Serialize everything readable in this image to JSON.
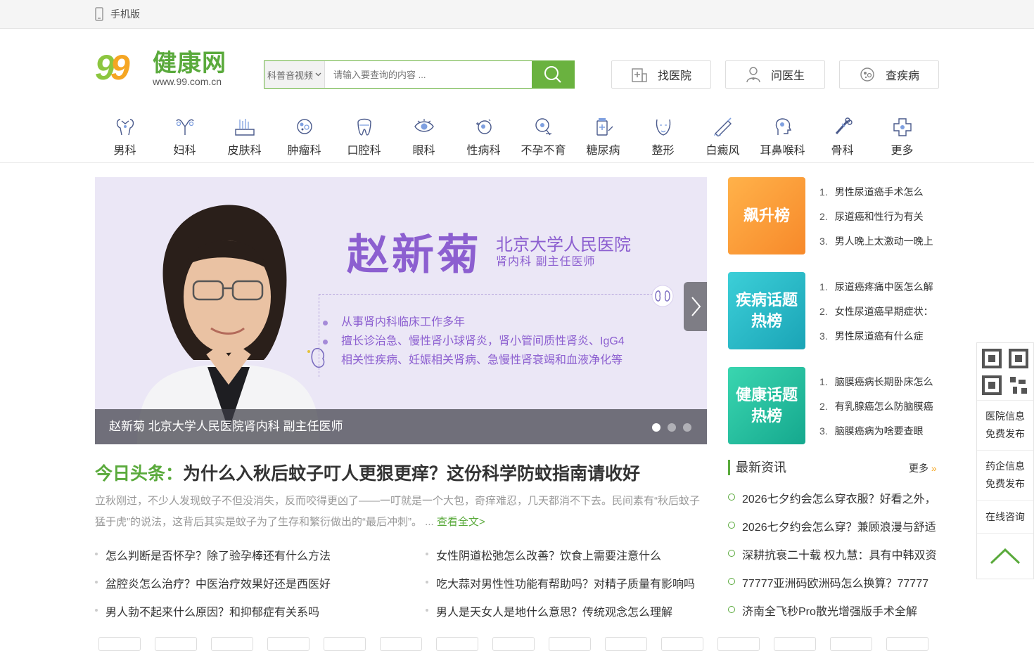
{
  "topbar": {
    "mobile_label": "手机版"
  },
  "logo": {
    "num": "99",
    "cn": "健康网",
    "url": "www.99.com.cn"
  },
  "search": {
    "select_value": "科普音视频",
    "placeholder": "请输入要查询的内容 ..."
  },
  "quick_buttons": {
    "hospital": "找医院",
    "doctor": "问医生",
    "disease": "查疾病"
  },
  "departments": [
    "男科",
    "妇科",
    "皮肤科",
    "肿瘤科",
    "口腔科",
    "眼科",
    "性病科",
    "不孕不育",
    "糖尿病",
    "整形",
    "白癜风",
    "耳鼻喉科",
    "骨科",
    "更多"
  ],
  "banner": {
    "doctor_name": "赵新菊",
    "hospital": "北京大学人民医院",
    "title": "肾内科  副主任医师",
    "bullet1": "从事肾内科临床工作多年",
    "bullet2_line1": "擅长诊治急、慢性肾小球肾炎，肾小管间质性肾炎、IgG4",
    "bullet2_line2": "相关性疾病、妊娠相关肾病、急慢性肾衰竭和血液净化等",
    "caption": "赵新菊 北京大学人民医院肾内科 副主任医师"
  },
  "headline": {
    "tag": "今日头条：",
    "title": "为什么入秋后蚊子叮人更狠更痒？这份科学防蚊指南请收好",
    "summary": "立秋刚过，不少人发现蚊子不但没消失，反而咬得更凶了——一叮就是一个大包，奇痒难忍，几天都消不下去。民间素有“秋后蚊子猛于虎”的说法，这背后其实是蚊子为了生存和繁衍做出的“最后冲刺”。 ... ",
    "more": "查看全文>"
  },
  "news": {
    "left": [
      "怎么判断是否怀孕？除了验孕棒还有什么方法",
      "盆腔炎怎么治疗？中医治疗效果好还是西医好",
      "男人勃不起来什么原因？和抑郁症有关系吗"
    ],
    "right": [
      "女性阴道松弛怎么改善？饮食上需要注意什么",
      "吃大蒜对男性性功能有帮助吗？对精子质量有影响吗",
      "男人是天女人是地什么意思？传统观念怎么理解"
    ]
  },
  "rankings": [
    {
      "label": "飙升榜",
      "items": [
        "男性尿道癌手术怎么",
        "尿道癌和性行为有关",
        "男人晚上太激动一晚上"
      ]
    },
    {
      "label_line1": "疾病话题",
      "label_line2": "热榜",
      "items": [
        "尿道癌疼痛中医怎么解",
        "女性尿道癌早期症状：",
        "男性尿道癌有什么症"
      ]
    },
    {
      "label_line1": "健康话题",
      "label_line2": "热榜",
      "items": [
        "脑膜癌病长期卧床怎么",
        "有乳腺癌怎么防脑膜癌",
        "脑膜癌病为啥要查眼"
      ]
    }
  ],
  "latest": {
    "title": "最新资讯",
    "more": "更多",
    "items": [
      "2026七夕约会怎么穿衣服？好看之外，",
      "2026七夕约会怎么穿？兼顾浪漫与舒适",
      "深耕抗衰二十载 权九慧：具有中韩双资",
      "77777亚洲码欧洲码怎么换算？77777",
      "济南全飞秒Pro散光增强版手术全解"
    ]
  },
  "sidebar": {
    "hospital_l1": "医院信息",
    "hospital_l2": "免费发布",
    "pharma_l1": "药企信息",
    "pharma_l2": "免费发布",
    "consult": "在线咨询"
  },
  "colors": {
    "brand_green": "#5aaa3c",
    "accent_orange": "#f5a623",
    "banner_purple": "#8c5fd0"
  },
  "icons": [
    "phone-icon",
    "search-icon",
    "hospital-icon",
    "doctor-icon",
    "disease-icon",
    "chevron-right-icon",
    "back-to-top-icon",
    "qr-code-icon"
  ]
}
